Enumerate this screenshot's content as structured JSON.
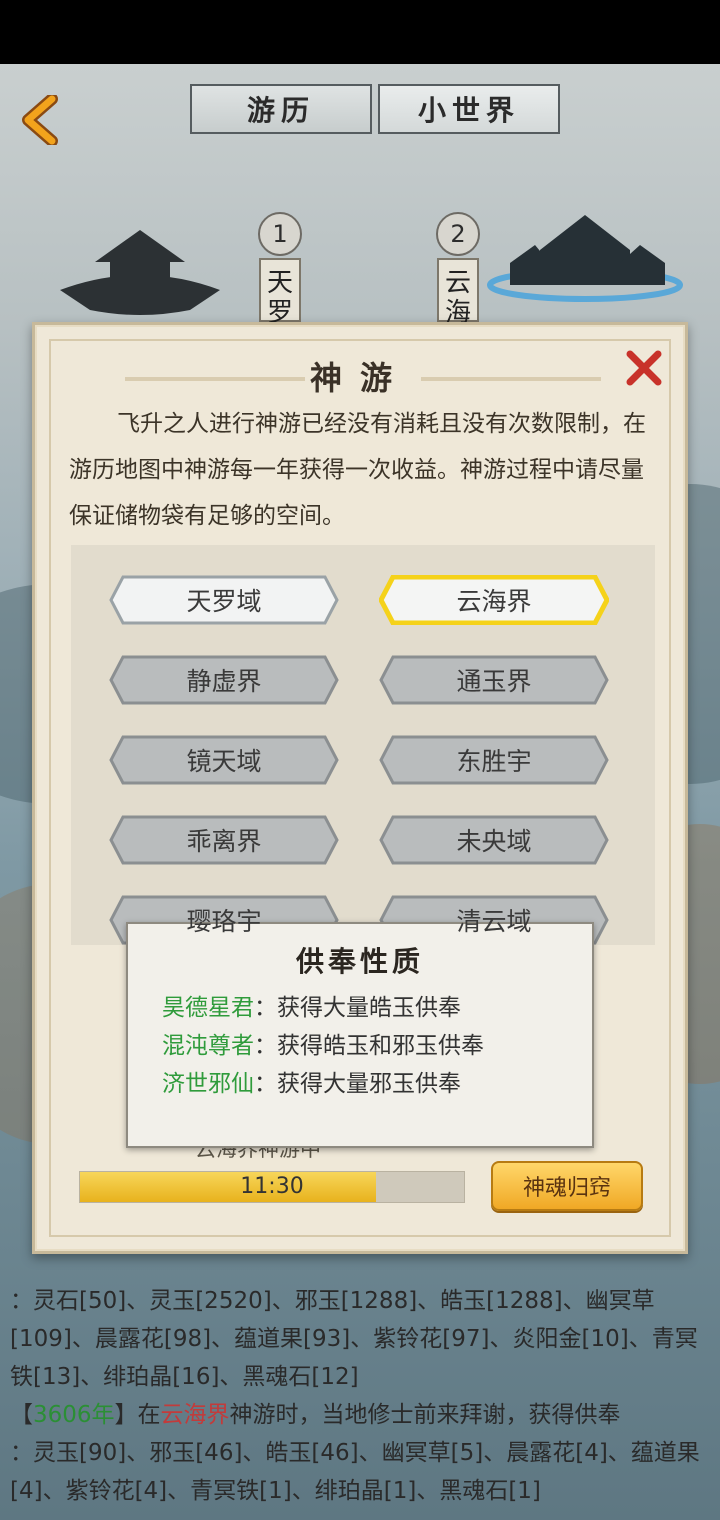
{
  "tabs": {
    "travel": "游历",
    "small_world": "小世界"
  },
  "stages": [
    {
      "number": "1",
      "name": "天罗"
    },
    {
      "number": "2",
      "name": "云海"
    }
  ],
  "dialog": {
    "title": "神游",
    "description": "飞升之人进行神游已经没有消耗且没有次数限制，在游历地图中神游每一年获得一次收益。神游过程中请尽量保证储物袋有足够的空间。",
    "realms": [
      {
        "label": "天罗域",
        "state": "available"
      },
      {
        "label": "云海界",
        "state": "selected"
      },
      {
        "label": "静虚界",
        "state": "locked"
      },
      {
        "label": "通玉界",
        "state": "locked"
      },
      {
        "label": "镜天域",
        "state": "locked"
      },
      {
        "label": "东胜宇",
        "state": "locked"
      },
      {
        "label": "乖离界",
        "state": "locked"
      },
      {
        "label": "未央域",
        "state": "locked"
      },
      {
        "label": "璎珞宇",
        "state": "locked"
      },
      {
        "label": "清云域",
        "state": "locked"
      }
    ],
    "status_label": "云海界神游中",
    "progress": {
      "time": "11:30",
      "fraction": 0.77
    },
    "return_button": "神魂归窍"
  },
  "tooltip": {
    "title": "供奉性质",
    "rows": [
      {
        "name": "昊德星君",
        "sep": "：",
        "desc": "获得大量皓玉供奉"
      },
      {
        "name": "混沌尊者",
        "sep": "：",
        "desc": "获得皓玉和邪玉供奉"
      },
      {
        "name": "济世邪仙",
        "sep": "：",
        "desc": "获得大量邪玉供奉"
      }
    ]
  },
  "log": {
    "line1": "：灵石[50]、灵玉[2520]、邪玉[1288]、皓玉[1288]、幽冥草[109]、晨露花[98]、蕴道果[93]、紫铃花[97]、炎阳金[10]、青冥铁[13]、绯珀晶[16]、黑魂石[12]",
    "entry_open": "【",
    "entry_year": "3606年",
    "entry_close": "】",
    "entry_in": "在",
    "entry_place": "云海界",
    "entry_text": "神游时，当地修士前来拜谢，获得供奉",
    "line3": "：灵玉[90]、邪玉[46]、皓玉[46]、幽冥草[5]、晨露花[4]、蕴道果[4]、紫铃花[4]、青冥铁[1]、绯珀晶[1]、黑魂石[1]"
  },
  "colors": {
    "accent_gold": "#f0a825",
    "selected_glow": "#f5d21a",
    "name_green": "#2f9b3b",
    "close_red": "#c8322a"
  }
}
